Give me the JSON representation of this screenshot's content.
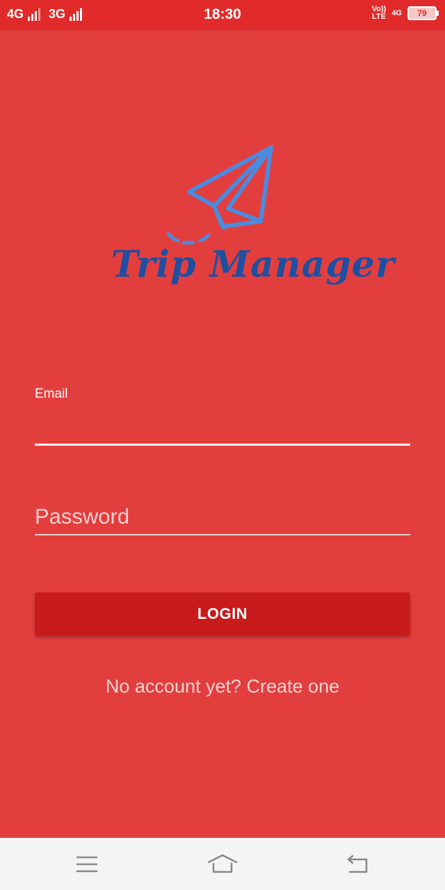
{
  "status_bar": {
    "network1": "4G",
    "network2": "3G",
    "time": "18:30",
    "volte_top": "Vo))",
    "volte_bottom": "LTE",
    "network3": "4G",
    "battery": "79"
  },
  "logo": {
    "text": "Trip Manager",
    "icon": "paper-plane-icon",
    "color": "#4a8be0"
  },
  "form": {
    "email_label": "Email",
    "email_value": "",
    "password_placeholder": "Password",
    "login_label": "LOGIN",
    "create_account_text": "No account yet? Create one"
  },
  "nav_bar": {
    "menu": "menu-icon",
    "home": "home-icon",
    "back": "back-icon"
  },
  "colors": {
    "background": "#e33e3e",
    "status_bar": "#e12a2a",
    "button": "#c81b1b",
    "logo_text": "#1f4fa0"
  }
}
